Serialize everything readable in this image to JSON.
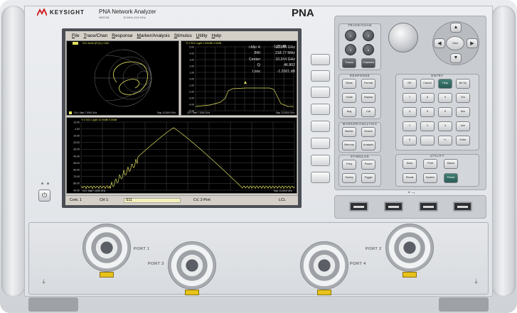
{
  "header": {
    "brand": "KEYSIGHT",
    "model": "PNA Network Analyzer",
    "model_sub1": "N5221B",
    "model_sub2": "10 MHz-13.5 GHz",
    "badge": "PNA"
  },
  "menu": [
    {
      "first": "F",
      "rest": "ile"
    },
    {
      "first": "T",
      "rest": "race/Chan"
    },
    {
      "first": "R",
      "rest": "esponse"
    },
    {
      "first": "M",
      "rest": "arker/Analysis"
    },
    {
      "first": "S",
      "rest": "timulus"
    },
    {
      "first": "U",
      "rest": "tility"
    },
    {
      "first": "H",
      "rest": "elp"
    }
  ],
  "plots": {
    "smith": {
      "title": "S11 Smith (R+jX) 1.00U",
      "foot_left": "Ch1: Start 7.2000 GHz",
      "foot_right": "Stop 13.2000 GHz"
    },
    "top_right": {
      "title": "Tr 2 S21 LogM 1.000dB/ 0.00dB",
      "foot_left": "Ch1: Start 7.2000 GHz",
      "foot_right": "Stop 13.2000 GHz",
      "y_ticks": [
        "5.00",
        "4.00",
        "3.00",
        "2.00",
        "1.00",
        "0.00",
        "-1.00",
        "-2.00",
        "-3.00",
        "-4.00",
        "-5.00"
      ]
    },
    "bottom": {
      "title": "Tr 3 S21 LogM 10.00dB/ 0.00dB",
      "foot_left": "Ch1: Start 7.2000 GHz",
      "foot_right": "Stop 13.2000 GHz",
      "y_ticks": [
        "10.00",
        "0.00",
        "-10.00",
        "-20.00",
        "-30.00",
        "-40.00",
        "-50.00",
        "-60.00",
        "-70.00",
        "-80.00",
        "-90.00"
      ]
    }
  },
  "marker": {
    "rows": [
      {
        "label": ">Mkr 4:",
        "value1": "10.244 GHz",
        "value2": "-1.26 dB"
      },
      {
        "label": "BW:",
        "value1": "218.77 MHz",
        "value2": ""
      },
      {
        "label": "Center:",
        "value1": "10.244 GHz",
        "value2": ""
      },
      {
        "label": "Q:",
        "value1": "46.802",
        "value2": ""
      },
      {
        "label": "Loss:",
        "value1": "-1.2601 dB",
        "value2": ""
      }
    ]
  },
  "status": {
    "channel": "Cont. 1",
    "ch_label": "CH 1:",
    "trace": "S11",
    "cal": "C∈ 2-Port",
    "mode": "LCL"
  },
  "panel": {
    "trace_chan": {
      "title": "TRACE/CHAN",
      "keys": [
        "1",
        "2",
        "3",
        "4"
      ],
      "extra": [
        "Traces",
        "Channels"
      ]
    },
    "response": {
      "title": "RESPONSE",
      "keys": [
        "Meas",
        "Format",
        "Scale",
        "Display",
        "Avg",
        "Cal"
      ]
    },
    "marker_analysis": {
      "title": "MARKER/ANALYSIS",
      "keys": [
        "Marker",
        "Search",
        "Memory",
        "Analysis"
      ]
    },
    "stimulus": {
      "title": "STIMULUS",
      "keys": [
        "Freq",
        "Power",
        "Sweep",
        "Trigger"
      ]
    },
    "entry": {
      "title": "ENTRY",
      "keys": [
        "OK",
        "Cancel",
        "Help",
        "Bk Sp",
        "7",
        "8",
        "9",
        "G/n",
        "4",
        "5",
        "6",
        "M/u",
        "1",
        "2",
        "3",
        "k/m",
        "0",
        ".",
        "+/-",
        "Enter"
      ]
    },
    "utility": {
      "title": "UTILITY",
      "keys": [
        "Save",
        "Print",
        "Macro",
        "Recall",
        "System",
        "Preset"
      ]
    },
    "nav_center": "Click"
  },
  "ports": [
    {
      "label": "PORT 1"
    },
    {
      "label": "PORT 3"
    },
    {
      "label": "PORT 4"
    },
    {
      "label": "PORT 2"
    }
  ],
  "colors": {
    "trace": "#e0e060",
    "screen_bg": "#000000",
    "preset_key": "#3f7f74"
  }
}
